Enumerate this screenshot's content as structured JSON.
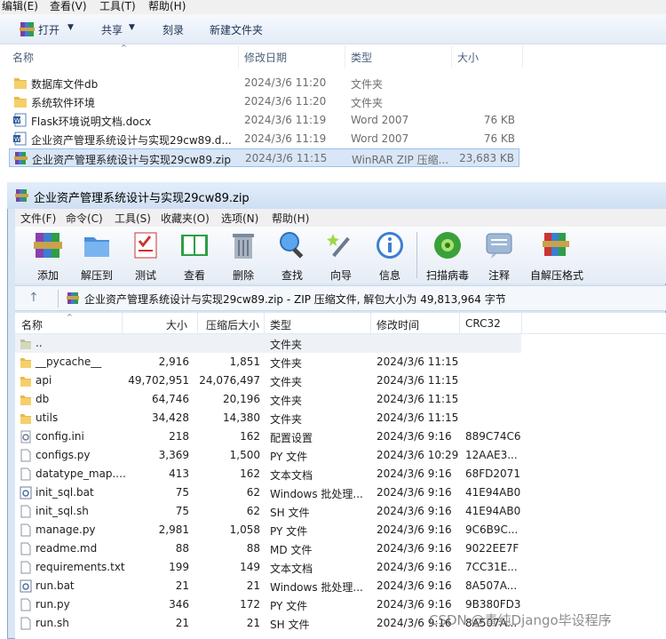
{
  "explorer": {
    "menu": [
      "编辑(E)",
      "查看(V)",
      "工具(T)",
      "帮助(H)"
    ],
    "toolbar": {
      "open": "打开",
      "share": "共享",
      "burn": "刻录",
      "new_folder": "新建文件夹"
    },
    "columns": {
      "name": "名称",
      "date": "修改日期",
      "type": "类型",
      "size": "大小"
    },
    "rows": [
      {
        "name": "数据库文件db",
        "date": "2024/3/6 11:20",
        "type": "文件夹",
        "size": "",
        "icon": "folder-icon"
      },
      {
        "name": "系统软件环境",
        "date": "2024/3/6 11:20",
        "type": "文件夹",
        "size": "",
        "icon": "folder-icon"
      },
      {
        "name": "Flask环境说明文档.docx",
        "date": "2024/3/6 11:19",
        "type": "Word 2007",
        "size": "76 KB",
        "icon": "word-doc-icon"
      },
      {
        "name": "企业资产管理系统设计与实现29cw89.d...",
        "date": "2024/3/6 11:19",
        "type": "Word 2007",
        "size": "76 KB",
        "icon": "word-doc-icon"
      },
      {
        "name": "企业资产管理系统设计与实现29cw89.zip",
        "date": "2024/3/6 11:15",
        "type": "WinRAR ZIP 压缩...",
        "size": "23,683 KB",
        "icon": "winrar-zip-icon"
      }
    ]
  },
  "winrar": {
    "title": "企业资产管理系统设计与实现29cw89.zip",
    "menu": [
      "文件(F)",
      "命令(C)",
      "工具(S)",
      "收藏夹(O)",
      "选项(N)",
      "帮助(H)"
    ],
    "tools": [
      {
        "label": "添加",
        "icon": "add-archive-icon"
      },
      {
        "label": "解压到",
        "icon": "extract-to-icon"
      },
      {
        "label": "测试",
        "icon": "test-icon"
      },
      {
        "label": "查看",
        "icon": "view-icon"
      },
      {
        "label": "删除",
        "icon": "delete-icon"
      },
      {
        "label": "查找",
        "icon": "find-icon"
      },
      {
        "label": "向导",
        "icon": "wizard-icon"
      },
      {
        "label": "信息",
        "icon": "info-icon"
      },
      {
        "label": "扫描病毒",
        "icon": "virus-scan-icon"
      },
      {
        "label": "注释",
        "icon": "comment-icon"
      },
      {
        "label": "自解压格式",
        "icon": "sfx-icon"
      }
    ],
    "path": "企业资产管理系统设计与实现29cw89.zip - ZIP 压缩文件, 解包大小为 49,813,964 字节",
    "columns": {
      "name": "名称",
      "size": "大小",
      "packed": "压缩后大小",
      "type": "类型",
      "modified": "修改时间",
      "crc": "CRC32"
    },
    "rows": [
      {
        "name": "..",
        "size": "",
        "packed": "",
        "type": "文件夹",
        "modified": "",
        "crc": "",
        "icon": "parent-folder-icon"
      },
      {
        "name": "__pycache__",
        "size": "2,916",
        "packed": "1,851",
        "type": "文件夹",
        "modified": "2024/3/6 11:15",
        "crc": "",
        "icon": "folder-icon"
      },
      {
        "name": "api",
        "size": "49,702,951",
        "packed": "24,076,497",
        "type": "文件夹",
        "modified": "2024/3/6 11:15",
        "crc": "",
        "icon": "folder-icon"
      },
      {
        "name": "db",
        "size": "64,746",
        "packed": "20,196",
        "type": "文件夹",
        "modified": "2024/3/6 11:15",
        "crc": "",
        "icon": "folder-icon"
      },
      {
        "name": "utils",
        "size": "34,428",
        "packed": "14,380",
        "type": "文件夹",
        "modified": "2024/3/6 11:15",
        "crc": "",
        "icon": "folder-icon"
      },
      {
        "name": "config.ini",
        "size": "218",
        "packed": "162",
        "type": "配置设置",
        "modified": "2024/3/6 9:16",
        "crc": "889C74C6",
        "icon": "settings-file-icon"
      },
      {
        "name": "configs.py",
        "size": "3,369",
        "packed": "1,500",
        "type": "PY 文件",
        "modified": "2024/3/6 10:29",
        "crc": "12AAE3...",
        "icon": "file-icon"
      },
      {
        "name": "datatype_map....",
        "size": "413",
        "packed": "162",
        "type": "文本文档",
        "modified": "2024/3/6 9:16",
        "crc": "68FD2071",
        "icon": "file-icon"
      },
      {
        "name": "init_sql.bat",
        "size": "75",
        "packed": "62",
        "type": "Windows 批处理...",
        "modified": "2024/3/6 9:16",
        "crc": "41E94AB0",
        "icon": "batch-file-icon"
      },
      {
        "name": "init_sql.sh",
        "size": "75",
        "packed": "62",
        "type": "SH 文件",
        "modified": "2024/3/6 9:16",
        "crc": "41E94AB0",
        "icon": "file-icon"
      },
      {
        "name": "manage.py",
        "size": "2,981",
        "packed": "1,058",
        "type": "PY 文件",
        "modified": "2024/3/6 9:16",
        "crc": "9C6B9C...",
        "icon": "file-icon"
      },
      {
        "name": "readme.md",
        "size": "88",
        "packed": "88",
        "type": "MD 文件",
        "modified": "2024/3/6 9:16",
        "crc": "9022EE7F",
        "icon": "file-icon"
      },
      {
        "name": "requirements.txt",
        "size": "199",
        "packed": "149",
        "type": "文本文档",
        "modified": "2024/3/6 9:16",
        "crc": "7CC31E...",
        "icon": "file-icon"
      },
      {
        "name": "run.bat",
        "size": "21",
        "packed": "21",
        "type": "Windows 批处理...",
        "modified": "2024/3/6 9:16",
        "crc": "8A507A...",
        "icon": "batch-file-icon"
      },
      {
        "name": "run.py",
        "size": "346",
        "packed": "172",
        "type": "PY 文件",
        "modified": "2024/3/6 9:16",
        "crc": "9B380FD3",
        "icon": "file-icon"
      },
      {
        "name": "run.sh",
        "size": "21",
        "packed": "21",
        "type": "SH 文件",
        "modified": "2024/3/6 9:16",
        "crc": "8A507A...",
        "icon": "file-icon"
      }
    ]
  },
  "watermark": "CSDN @青纯Django毕设程序"
}
